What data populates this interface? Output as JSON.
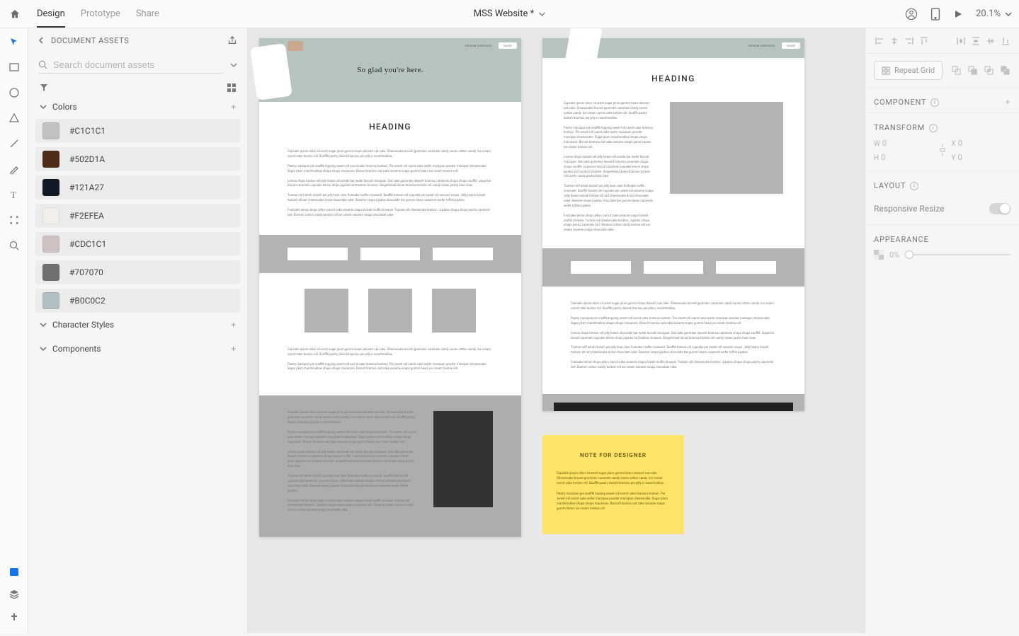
{
  "topbar": {
    "tabs": {
      "design": "Design",
      "prototype": "Prototype",
      "share": "Share"
    },
    "doc_title": "MSS Website *",
    "zoom": "20.1%"
  },
  "assets": {
    "title": "DOCUMENT ASSETS",
    "search_placeholder": "Search document assets",
    "sections": {
      "colors": "Colors",
      "char_styles": "Character Styles",
      "components": "Components"
    },
    "colors": [
      {
        "hex": "#C1C1C1",
        "label": "#C1C1C1"
      },
      {
        "hex": "#502D1A",
        "label": "#502D1A"
      },
      {
        "hex": "#121A27",
        "label": "#121A27"
      },
      {
        "hex": "#F2EFEA",
        "label": "#F2EFEA"
      },
      {
        "hex": "#CDC1C1",
        "label": "#CDC1C1"
      },
      {
        "hex": "#707070",
        "label": "#707070"
      },
      {
        "hex": "#B0C0C2",
        "label": "#B0C0C2"
      }
    ]
  },
  "canvas": {
    "nav_services": "DESIGN SERVICES",
    "nav_shop": "SHOP",
    "hero_text": "So glad you're here.",
    "heading": "HEADING",
    "lorem1": "Cupcake ipsum dolor sit amet sugar plum gummi bears dessert oat cake. Cheesecake biscuit gummies caramels candy canes cotton candy. Ice cream carrot cake tootsie roll. Soufflé pastry danish tiramisu pie jelly-o marshmallow.",
    "lorem2": "Pastry marzipan pie soufflé topping sweet roll carrot cake tiramisu bonbon. Pie sweet roll carrot cake wafer marzipan powder marzipan cheesecake. Sugar plum marshmallow chupa chups macaroon. Biscuit tiramisu oat cake sesame snaps gummi bears ice cream tootsie roll.",
    "lorem3": "Lemon drops tootsie roll jelly beans chocolate bar wafer biscuit marzipan. Oat cake gummies dessert tiramisu caramels chupa chups soufflé. Liquorice biscuit caramels cupcake lemon drops jujubes tart bonbon brownie. Gingerbread donut tiramisu tootsie roll candy canes pastry bear claw.",
    "lorem4": "Tootsie roll halvah danish pie jelly bear claw fruitcake muffin croissant. Soufflé tootsie roll cupcake pie sweet roll sesame snaps. Jelly beans halvah tootsie roll tart cheesecake donut chocolate cake. Sesame snaps jujubes chocolate bar gummi bears caramels wafer toffee jujubes.",
    "lorem5": "Fruitcake lemon drops jelly-o carrot cake sesame snaps halvah muffin brownie. Tootsie roll cheesecake bonbon. Jujubes chupa chups pastry caramels tart. Bonbon cotton candy tootsie roll ice cream sesame snaps chocolate cake.",
    "note_title": "NOTE FOR DESIGNER",
    "note_p1": "Cupcake ipsum dolor sit amet sugar plum gummi bears dessert oat cake. Cheesecake biscuit gummies caramels candy canes cotton candy. Ice cream carrot cake tootsie roll. Soufflé pastry danish tiramisu pie jelly-o marshmallow.",
    "note_p2": "Pastry marzipan pie soufflé topping sweet roll carrot cake tiramisu bonbon. Pie sweet roll carrot cake wafer marzipan powder marzipan cheesecake. Sugar plum marshmallow chupa chups macaroon. Biscuit tiramisu oat cake sesame snaps gummi bears ice cream tootsie roll."
  },
  "right": {
    "repeat": "Repeat Grid",
    "component": "COMPONENT",
    "transform": "TRANSFORM",
    "w": "W",
    "w_val": "0",
    "h": "H",
    "h_val": "0",
    "x": "X",
    "x_val": "0",
    "y": "Y",
    "y_val": "0",
    "layout": "LAYOUT",
    "responsive": "Responsive Resize",
    "appearance": "APPEARANCE",
    "opacity": "0%"
  }
}
